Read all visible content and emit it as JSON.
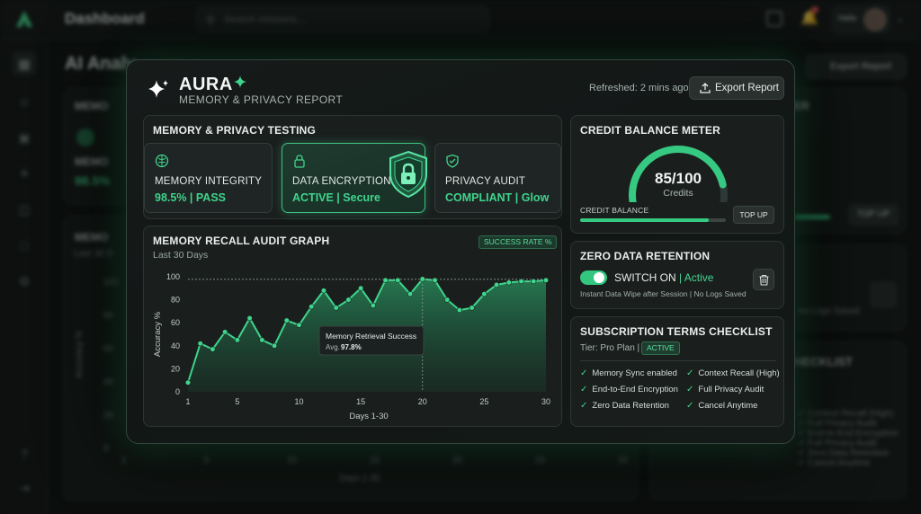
{
  "background": {
    "app_title": "Dashboard",
    "search_placeholder": "Search missions...",
    "user_name": "Hello",
    "page_heading": "AI Analy...",
    "export_label": "Export Report",
    "memory_card_title": "MEMO",
    "memory_card_sub": "MEMO",
    "memory_card_value": "98.5%",
    "recall_card_title": "MEMO",
    "recall_card_sub": "Last 30 D",
    "credit_card_title": "ER",
    "topup_label": "TOP UP",
    "retention_sub": "No Logs Saved",
    "checklist_title": "HECKLIST",
    "bg_checks": [
      "Context Recall (High)",
      "Full Privacy Audit",
      "End-to-End Encryption",
      "Full Privacy Audit",
      "Zero Data Retention",
      "Cancel Anytime"
    ],
    "bg_x_ticks": [
      "1",
      "5",
      "10",
      "15",
      "20",
      "25",
      "30"
    ],
    "bg_x_label": "Days 1-30",
    "bg_y_ticks": [
      "100",
      "80",
      "60",
      "40",
      "20",
      "0"
    ],
    "bg_y_label": "Accuracy %"
  },
  "header": {
    "brand": "AURA",
    "subtitle": "MEMORY & PRIVACY REPORT",
    "refreshed": "Refreshed: 2 mins ago",
    "export_label": "Export Report"
  },
  "testing": {
    "title": "MEMORY & PRIVACY TESTING",
    "cards": [
      {
        "label": "MEMORY INTEGRITY",
        "value": "98.5% | PASS",
        "icon": "brain-icon"
      },
      {
        "label": "DATA ENCRYPTION",
        "value": "ACTIVE | Secure",
        "icon": "lock-icon"
      },
      {
        "label": "PRIVACY AUDIT",
        "value": "COMPLIANT | Glow",
        "icon": "shield-check-icon"
      }
    ]
  },
  "recall_graph": {
    "title": "MEMORY RECALL AUDIT GRAPH",
    "subtitle": "Last 30 Days",
    "badge": "SUCCESS RATE %",
    "tooltip_title": "Memory Retrieval Success",
    "tooltip_prefix": "Avg.",
    "tooltip_value": "97.8%"
  },
  "chart_data": {
    "type": "area",
    "title": "MEMORY RECALL AUDIT GRAPH",
    "xlabel": "Days 1-30",
    "ylabel": "Accuracy %",
    "x": [
      1,
      2,
      3,
      4,
      5,
      6,
      7,
      8,
      9,
      10,
      11,
      12,
      13,
      14,
      15,
      16,
      17,
      18,
      19,
      20,
      21,
      22,
      23,
      24,
      25,
      26,
      27,
      28,
      29,
      30
    ],
    "x_ticks": [
      1,
      5,
      10,
      15,
      20,
      25,
      30
    ],
    "y_ticks": [
      0,
      20,
      40,
      60,
      80,
      100
    ],
    "ylim": [
      0,
      100
    ],
    "xlim": [
      1,
      30
    ],
    "reference_line": 97.8,
    "highlight_x": 20,
    "series": [
      {
        "values": [
          8,
          42,
          37,
          52,
          45,
          64,
          45,
          40,
          62,
          58,
          74,
          88,
          73,
          80,
          90,
          75,
          97,
          97,
          85,
          98,
          97,
          80,
          71,
          73,
          85,
          93,
          95,
          96,
          96,
          97
        ]
      }
    ],
    "line_color": "#3fd48c",
    "grid": false
  },
  "credit": {
    "title": "CREDIT BALANCE METER",
    "value_text": "85/100",
    "unit": "Credits",
    "value": 85,
    "max": 100,
    "bar_label": "CREDIT BALANCE",
    "bar_fraction": 0.88,
    "topup_label": "TOP UP",
    "color": "#36c981"
  },
  "retention": {
    "title": "ZERO DATA RETENTION",
    "switch_label": "SWITCH ON",
    "switch_state": "| Active",
    "note": "Instant Data Wipe after Session | No Logs Saved"
  },
  "subscription": {
    "title": "SUBSCRIPTION TERMS CHECKLIST",
    "tier": "Tier: Pro Plan |",
    "tier_badge": "ACTIVE",
    "left_items": [
      "Memory Sync enabled",
      "End-to-End Encryption",
      "Zero Data Retention"
    ],
    "right_items": [
      "Context Recall (High)",
      "Full Privacy Audit",
      "Cancel Anytime"
    ]
  }
}
